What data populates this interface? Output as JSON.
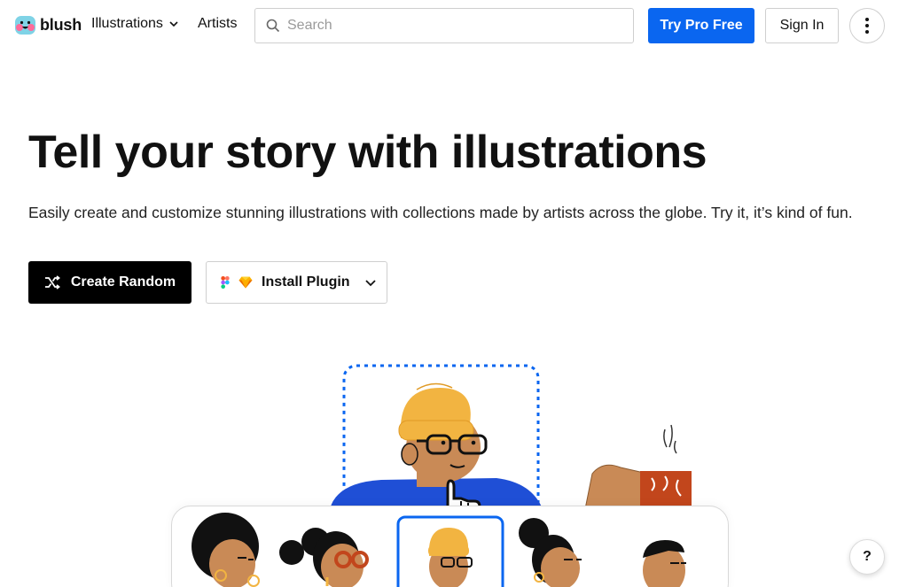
{
  "nav": {
    "logo_text": "blush",
    "illustrations_label": "Illustrations",
    "artists_label": "Artists",
    "search_placeholder": "Search",
    "try_pro_label": "Try Pro Free",
    "sign_in_label": "Sign In"
  },
  "hero": {
    "title": "Tell your story with illustrations",
    "subtitle": "Easily create and customize stunning illustrations with collections made by artists across the globe. Try it, it’s kind of fun.",
    "create_random_label": "Create Random",
    "install_plugin_label": "Install Plugin"
  },
  "help_label": "?",
  "colors": {
    "accent": "#0a66f0",
    "dark": "#000000",
    "hat": "#f2b441",
    "skin": "#c98a56",
    "shirt": "#1f4fd6",
    "mug": "#c2461c"
  }
}
